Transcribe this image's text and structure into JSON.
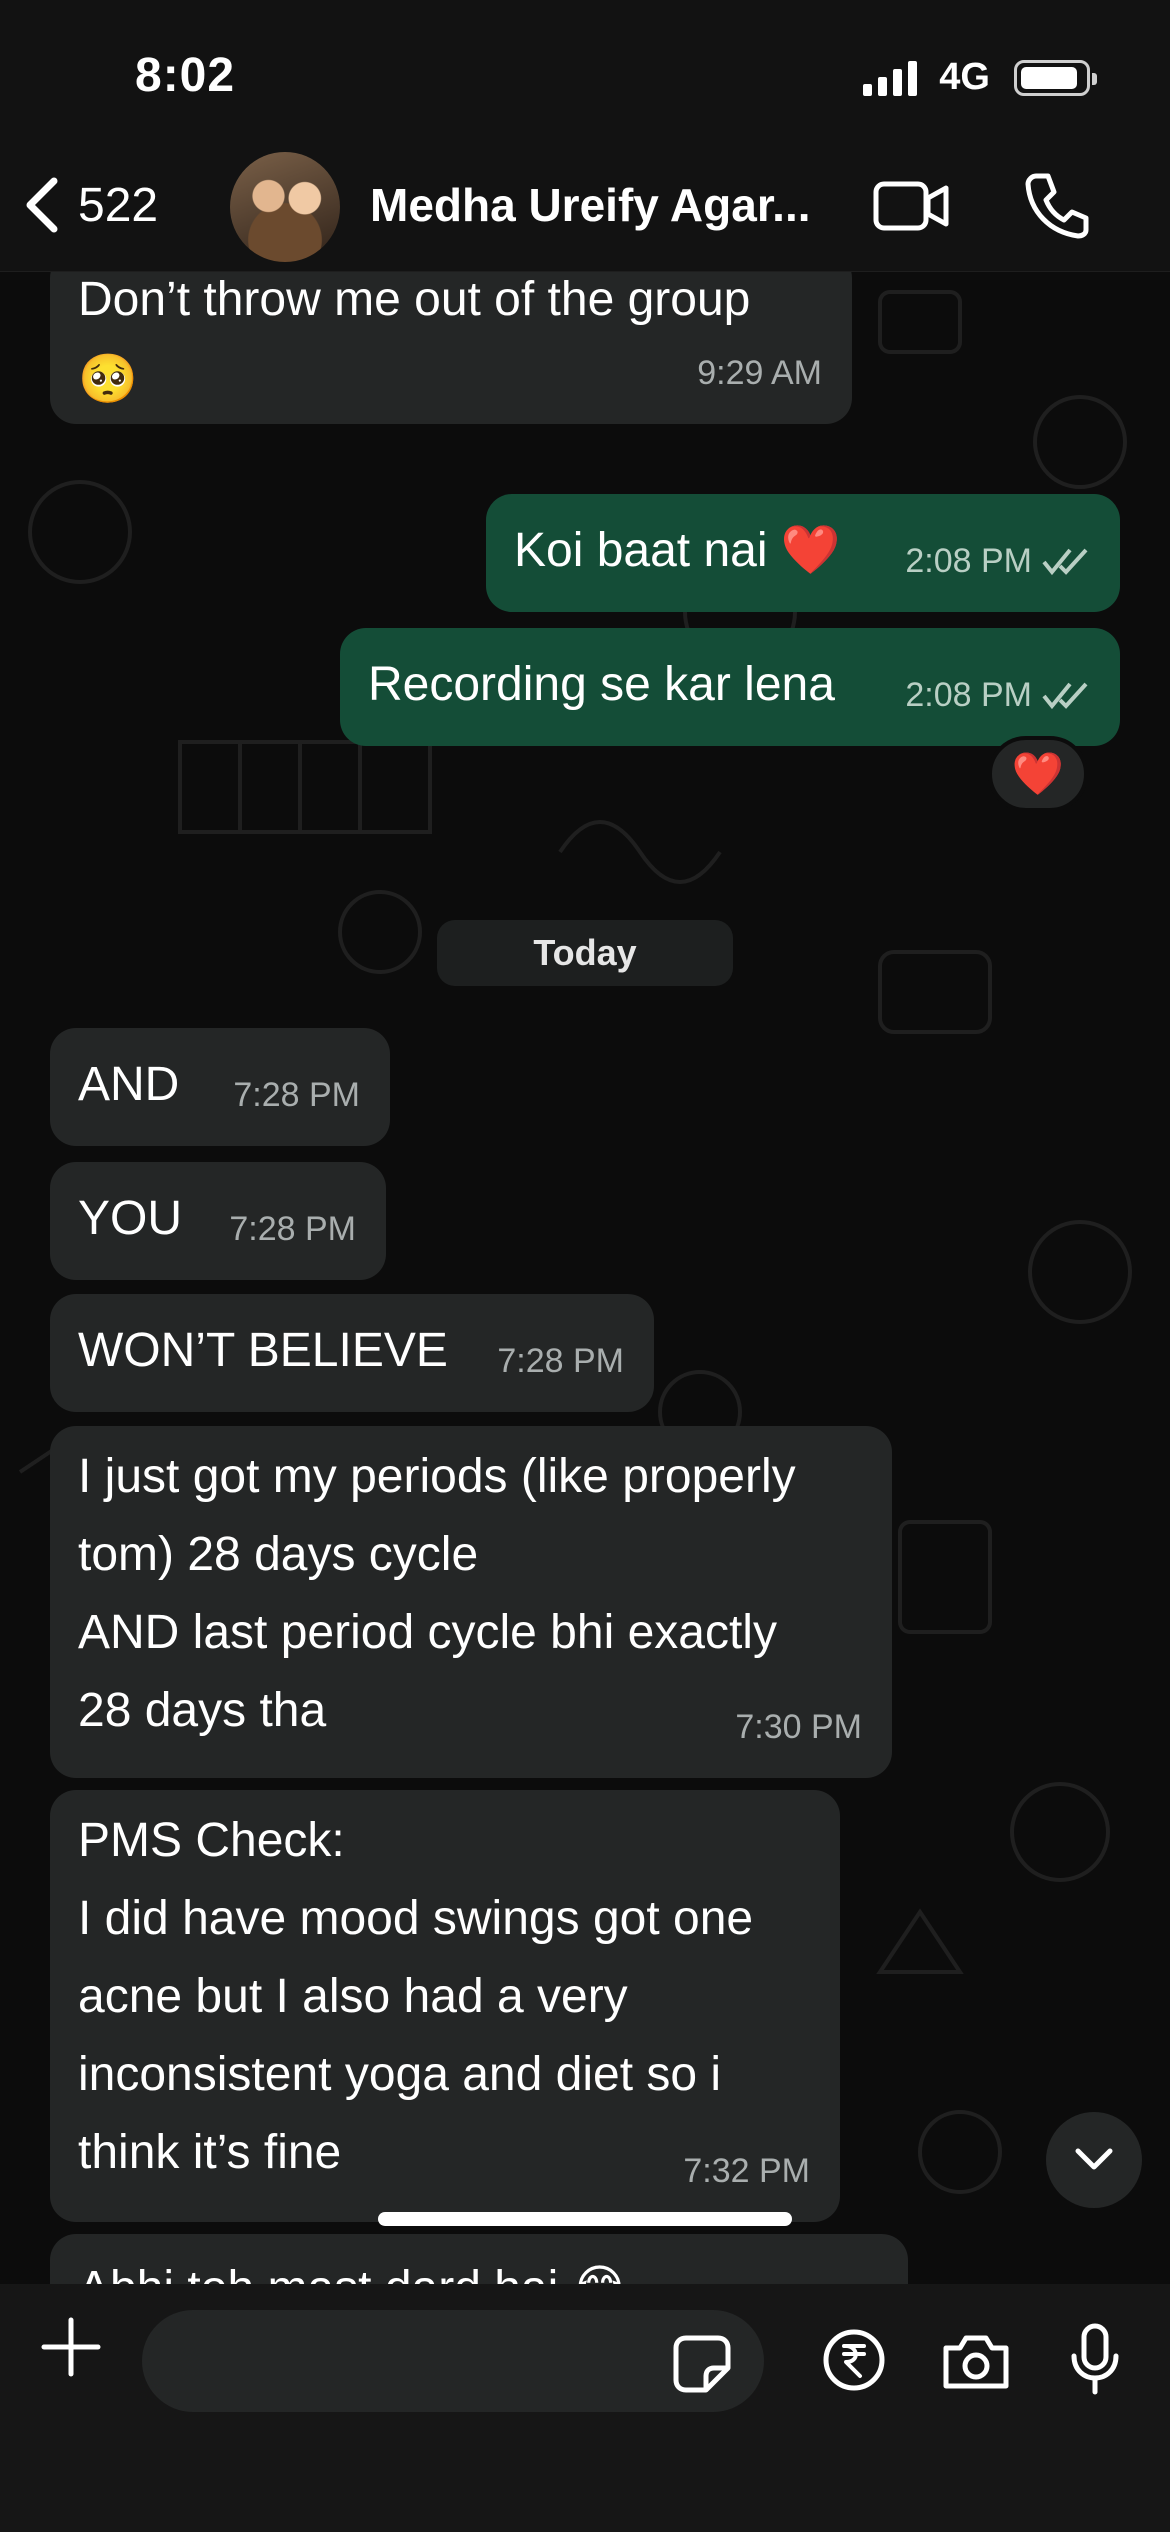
{
  "status_bar": {
    "time": "8:02",
    "network": "4G"
  },
  "header": {
    "back_count": "522",
    "chat_title": "Medha Ureify Agar..."
  },
  "messages": [
    {
      "text": "Don’t throw me out of the group\n🥺",
      "time": "9:29 AM",
      "direction": "in"
    },
    {
      "text": "Koi baat nai ❤️",
      "time": "2:08 PM",
      "direction": "out"
    },
    {
      "text": "Recording se kar lena",
      "time": "2:08 PM",
      "direction": "out"
    },
    {
      "text": "AND",
      "time": "7:28 PM",
      "direction": "in"
    },
    {
      "text": "YOU",
      "time": "7:28 PM",
      "direction": "in"
    },
    {
      "text": "WON’T BELIEVE",
      "time": "7:28 PM",
      "direction": "in"
    },
    {
      "text": "I just got my periods (like properly\ntom) 28 days cycle\nAND last period cycle bhi exactly\n28 days tha",
      "time": "7:30 PM",
      "direction": "in"
    },
    {
      "text": "PMS Check:\nI did have mood swings got one\nacne but I also had a very\ninconsistent yoga and diet so i\nthink it’s fine",
      "time": "7:32 PM",
      "direction": "in"
    },
    {
      "text": "Abhi toh mast dard hai 😂",
      "time": "",
      "direction": "in"
    }
  ],
  "reaction": "❤️",
  "date_divider": "Today",
  "composer": {
    "placeholder": ""
  },
  "colors": {
    "incoming_bubble": "#242626",
    "outgoing_bubble": "#144d37",
    "background": "#0c0c0c"
  },
  "icons": [
    "back-chevron-icon",
    "video-call-icon",
    "phone-icon",
    "plus-icon",
    "sticker-icon",
    "rupee-icon",
    "camera-icon",
    "mic-icon",
    "chevron-down-icon",
    "double-check-icon"
  ]
}
